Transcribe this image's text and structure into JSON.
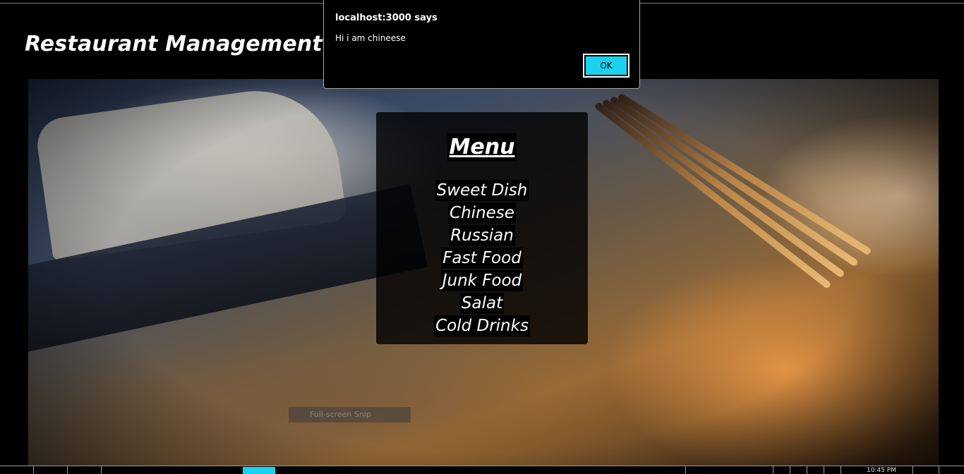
{
  "header": {
    "title": "Restaurant Management sys"
  },
  "menu": {
    "title": "Menu",
    "items": [
      "Sweet Dish",
      "Chinese",
      "Russian",
      "Fast Food",
      "Junk Food",
      "Salat",
      "Cold Drinks"
    ]
  },
  "dialog": {
    "title": "localhost:3000 says",
    "message": "Hi i am chineese",
    "ok_label": "OK"
  },
  "overlay": {
    "snip_label": "Full-screen Snip"
  },
  "taskbar": {
    "time": "10:45 PM"
  },
  "colors": {
    "accent": "#1ad2ee",
    "background": "#000000"
  }
}
